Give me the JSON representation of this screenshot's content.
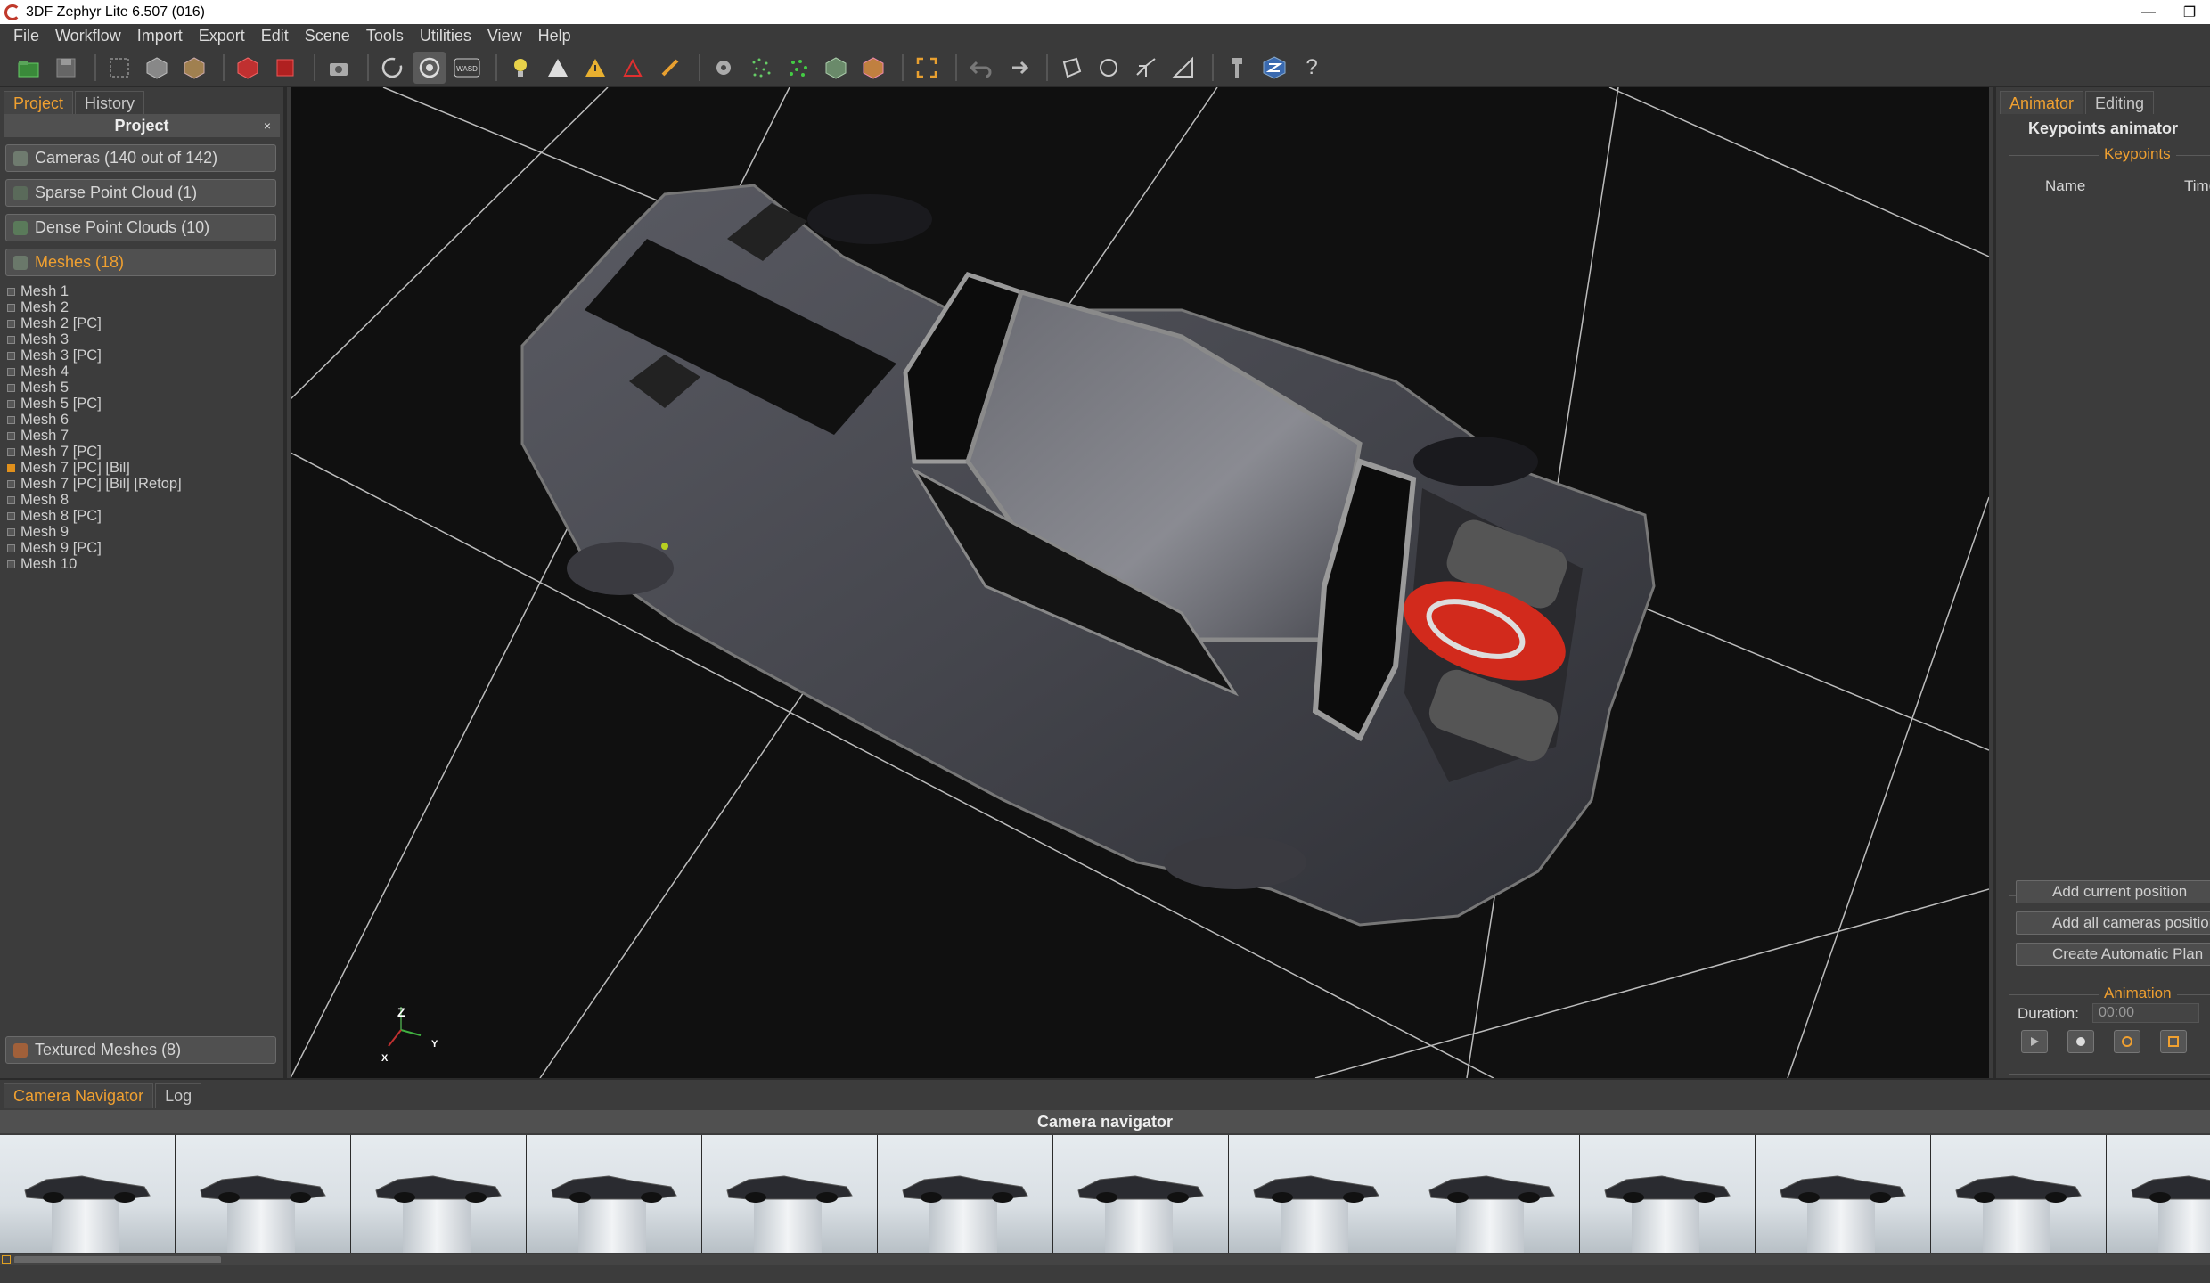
{
  "window": {
    "title": "3DF Zephyr Lite 6.507 (016)"
  },
  "menu": [
    "File",
    "Workflow",
    "Import",
    "Export",
    "Edit",
    "Scene",
    "Tools",
    "Utilities",
    "View",
    "Help"
  ],
  "toolbar": {
    "icons": [
      "open-project-icon",
      "save-icon",
      "select-rect-icon",
      "cube-icon",
      "cube-shaded-icon",
      "box-red-icon",
      "box-remove-icon",
      "camera-icon",
      "rotate-orbit-icon",
      "rotate-free-icon",
      "wasd-icon",
      "light-bulb-icon",
      "vertex-icon",
      "warning-icon",
      "red-triangle-icon",
      "brush-icon",
      "gear-select-icon",
      "point-cloud-icon",
      "point-cloud-green-icon",
      "mesh-cube-icon",
      "texture-cube-icon",
      "frame-icon",
      "undo-icon",
      "redo-icon",
      "lasso-icon",
      "circle-select-icon",
      "pick-icon",
      "ruler-icon",
      "tool-icon",
      "zephyr-logo-icon",
      "help-icon"
    ],
    "wasd_label": "WASD",
    "help_label": "?"
  },
  "left_panel": {
    "tabs": [
      "Project",
      "History"
    ],
    "active_tab": "Project",
    "header": "Project",
    "close_label": "×",
    "groups": {
      "cameras": "Cameras (140 out of 142)",
      "sparse": "Sparse Point Cloud (1)",
      "dense": "Dense Point Clouds (10)",
      "meshes": "Meshes (18)",
      "textured": "Textured Meshes (8)"
    },
    "meshes": [
      {
        "name": "Mesh 1",
        "selected": false
      },
      {
        "name": "Mesh 2",
        "selected": false
      },
      {
        "name": "Mesh 2 [PC]",
        "selected": false
      },
      {
        "name": "Mesh 3",
        "selected": false
      },
      {
        "name": "Mesh 3 [PC]",
        "selected": false
      },
      {
        "name": "Mesh 4",
        "selected": false
      },
      {
        "name": "Mesh 5",
        "selected": false
      },
      {
        "name": "Mesh 5 [PC]",
        "selected": false
      },
      {
        "name": "Mesh 6",
        "selected": false
      },
      {
        "name": "Mesh 7",
        "selected": false
      },
      {
        "name": "Mesh 7 [PC]",
        "selected": false
      },
      {
        "name": "Mesh 7 [PC] [Bil]",
        "selected": true
      },
      {
        "name": "Mesh 7 [PC] [Bil] [Retop]",
        "selected": false
      },
      {
        "name": "Mesh 8",
        "selected": false
      },
      {
        "name": "Mesh 8 [PC]",
        "selected": false
      },
      {
        "name": "Mesh 9",
        "selected": false
      },
      {
        "name": "Mesh 9 [PC]",
        "selected": false
      },
      {
        "name": "Mesh 10",
        "selected": false
      }
    ]
  },
  "viewport": {
    "axes": {
      "z": "Z",
      "y": "Y",
      "x": "X"
    },
    "colors": {
      "background": "#101010",
      "grid": "#bcbcbc",
      "car_body": "#4a4b52",
      "engine_red": "#d22a1c"
    }
  },
  "right_panel": {
    "tabs": [
      "Animator",
      "Editing"
    ],
    "active_tab": "Animator",
    "title": "Keypoints animator",
    "keypoints_legend": "Keypoints",
    "columns": [
      "Name",
      "Time"
    ],
    "buttons": [
      "Add current position",
      "Add all cameras positions",
      "Create Automatic Plan"
    ],
    "animation_legend": "Animation",
    "duration_label": "Duration:",
    "duration_value": "00:00"
  },
  "bottom_panel": {
    "tabs": [
      "Camera Navigator",
      "Log"
    ],
    "active_tab": "Camera Navigator",
    "title": "Camera navigator",
    "thumbnail_count": 13
  },
  "accent_color": "#f0a030"
}
